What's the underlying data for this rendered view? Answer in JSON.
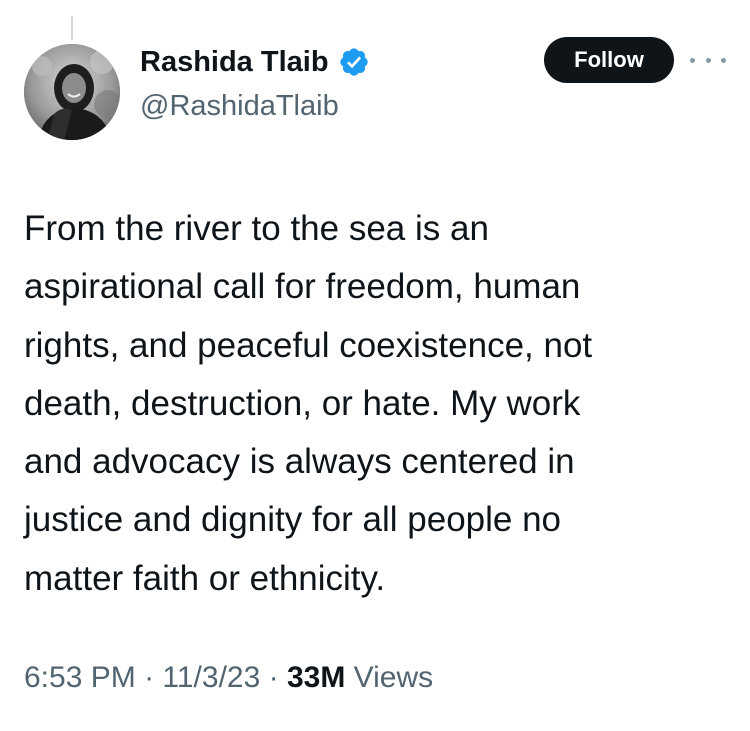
{
  "author": {
    "display_name": "Rashida Tlaib",
    "handle": "@RashidaTlaib",
    "verified_icon": "verified-badge-icon",
    "avatar_description": "profile-photo"
  },
  "actions": {
    "follow_label": "Follow",
    "more_icon": "more-horizontal-icon"
  },
  "tweet": {
    "lines": [
      "From the river to the sea is an",
      "aspirational call for freedom, human",
      "rights, and peaceful coexistence, not",
      "death, destruction, or hate. My work",
      "and advocacy is always centered in",
      "justice and dignity for all people no",
      "matter faith or ethnicity."
    ]
  },
  "meta": {
    "time": "6:53 PM",
    "separator": " · ",
    "date": "11/3/23",
    "views_count": "33M",
    "views_label": " Views"
  },
  "colors": {
    "verified_blue": "#1d9bf0",
    "text_primary": "#0f1419",
    "text_secondary": "#536471",
    "button_bg": "#0f1419"
  }
}
